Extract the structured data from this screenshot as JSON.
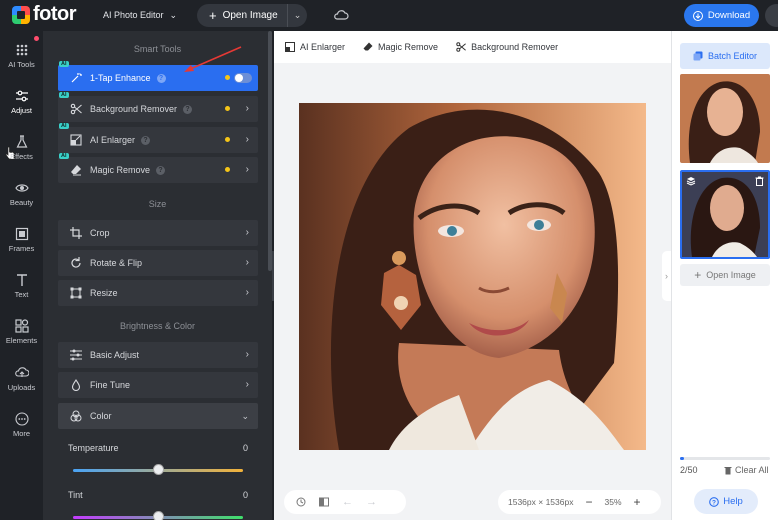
{
  "app": {
    "logo_text": "fotor",
    "mode": "AI Photo Editor"
  },
  "topbar": {
    "open_image": "Open Image",
    "download": "Download"
  },
  "rail": [
    {
      "label": "AI Tools",
      "icon": "grid-icon"
    },
    {
      "label": "Adjust",
      "icon": "sliders-icon"
    },
    {
      "label": "Effects",
      "icon": "flask-icon"
    },
    {
      "label": "Beauty",
      "icon": "eye-icon"
    },
    {
      "label": "Frames",
      "icon": "frame-icon"
    },
    {
      "label": "Text",
      "icon": "text-icon"
    },
    {
      "label": "Elements",
      "icon": "shapes-icon"
    },
    {
      "label": "Uploads",
      "icon": "upload-icon"
    },
    {
      "label": "More",
      "icon": "more-icon"
    }
  ],
  "panel": {
    "smart_tools_title": "Smart Tools",
    "smart_tools": [
      {
        "label": "1-Tap Enhance",
        "badge": "AI"
      },
      {
        "label": "Background Remover",
        "badge": "AI"
      },
      {
        "label": "AI Enlarger",
        "badge": "AI"
      },
      {
        "label": "Magic Remove",
        "badge": "AI"
      }
    ],
    "size_title": "Size",
    "size_tools": [
      "Crop",
      "Rotate & Flip",
      "Resize"
    ],
    "brightness_title": "Brightness & Color",
    "color_tools": [
      "Basic Adjust",
      "Fine Tune",
      "Color"
    ],
    "sliders": [
      {
        "label": "Temperature",
        "value": "0",
        "level": 0.5
      },
      {
        "label": "Tint",
        "value": "0",
        "level": 0.5
      }
    ]
  },
  "toolbar": {
    "tabs": [
      "AI Enlarger",
      "Magic Remove",
      "Background Remover"
    ]
  },
  "canvas": {
    "dimensions": "1536px × 1536px",
    "zoom": "35%"
  },
  "right": {
    "batch_editor": "Batch Editor",
    "open_image": "Open Image",
    "count_current": "2",
    "count_total": "/50",
    "clear_all": "Clear All",
    "help": "Help",
    "progress": 0.04
  },
  "colors": {
    "accent": "#2a6ef0",
    "ai_badge": "#3ad0c8",
    "status_dot": "#f5c518"
  }
}
